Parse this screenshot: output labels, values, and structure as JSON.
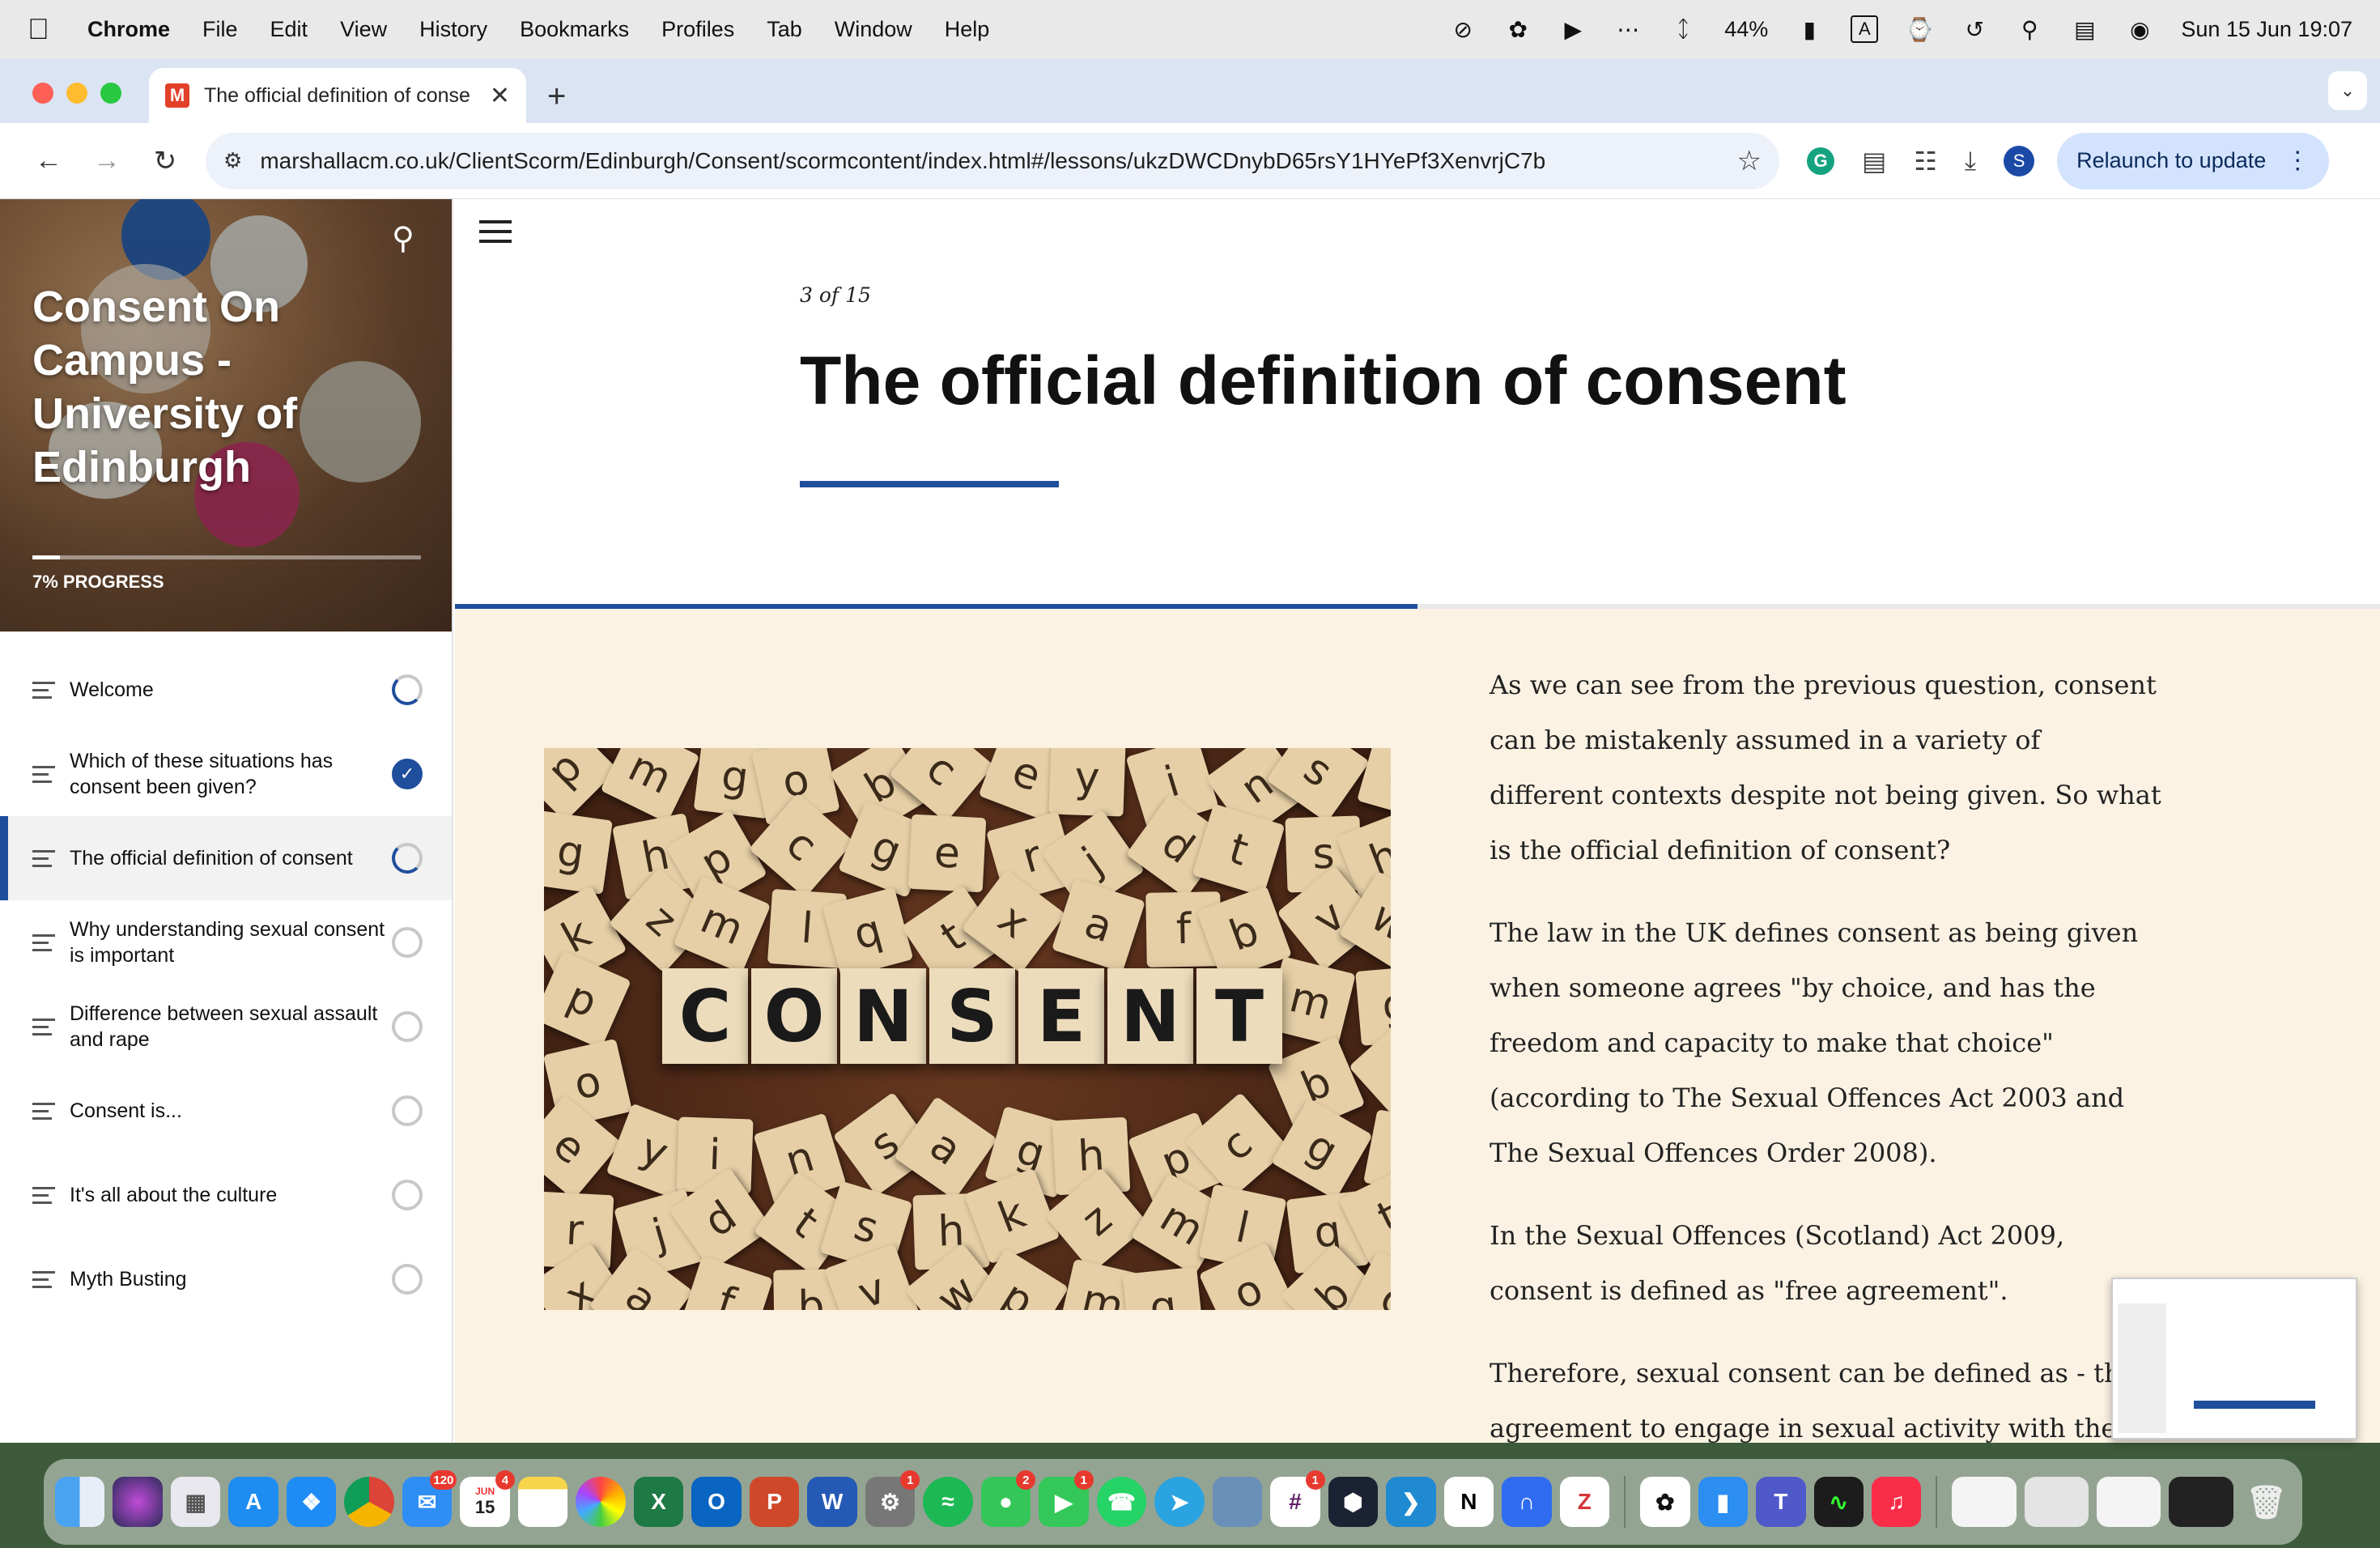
{
  "menubar": {
    "apple": "",
    "items": [
      "Chrome",
      "File",
      "Edit",
      "View",
      "History",
      "Bookmarks",
      "Profiles",
      "Tab",
      "Window",
      "Help"
    ],
    "battery": "44%",
    "input_source": "A",
    "datetime": "Sun 15 Jun  19:07"
  },
  "browser": {
    "tab_title": "The official definition of consent",
    "url": "marshallacm.co.uk/ClientScorm/Edinburgh/Consent/scormcontent/index.html#/lessons/ukzDWCDnybD65rsY1HYePf3XenvrjC7b",
    "profile_initial": "S",
    "relaunch_label": "Relaunch to update",
    "favicon_letter": "M"
  },
  "course": {
    "title": "Consent On Campus - University of Edinburgh",
    "progress_percent": 7,
    "progress_label": "7% PROGRESS",
    "lessons": [
      {
        "label": "Welcome",
        "status": "partial"
      },
      {
        "label": "Which of these situations has consent been given?",
        "status": "done"
      },
      {
        "label": "The official definition of consent",
        "status": "partial",
        "active": true
      },
      {
        "label": "Why understanding sexual consent is important",
        "status": "empty"
      },
      {
        "label": "Difference between sexual assault and rape",
        "status": "empty"
      },
      {
        "label": "Consent is...",
        "status": "empty"
      },
      {
        "label": "It's all about the culture",
        "status": "empty"
      },
      {
        "label": "Myth Busting",
        "status": "empty"
      }
    ]
  },
  "lesson": {
    "count": "3 of 15",
    "title": "The official definition of consent",
    "image_word": "CONSENT",
    "paragraphs": [
      "As we can see from the previous question, consent can be mistakenly assumed in a variety of different contexts despite not being given.  So what is the official definition of consent?",
      " The law in the UK defines consent as being given when someone agrees \"by choice, and has the freedom and capacity to make that choice\" (according to The Sexual Offences Act 2003 and The Sexual Offences Order 2008).",
      " In the Sexual Offences (Scotland) Act 2009, consent is defined as \"free agreement\".",
      " Therefore, sexual consent can be defined as - the agreement to engage in sexual activity with the freedom and capacity to do so."
    ]
  },
  "dock": {
    "calendar_month": "JUN",
    "calendar_day": "15",
    "badges": {
      "mail": "120",
      "calendar": "4",
      "settings": "1",
      "messages": "2",
      "facetime": "1",
      "slack": "1"
    }
  },
  "colors": {
    "accent": "#1f4e9c",
    "content_bg": "#fbf2e3"
  }
}
